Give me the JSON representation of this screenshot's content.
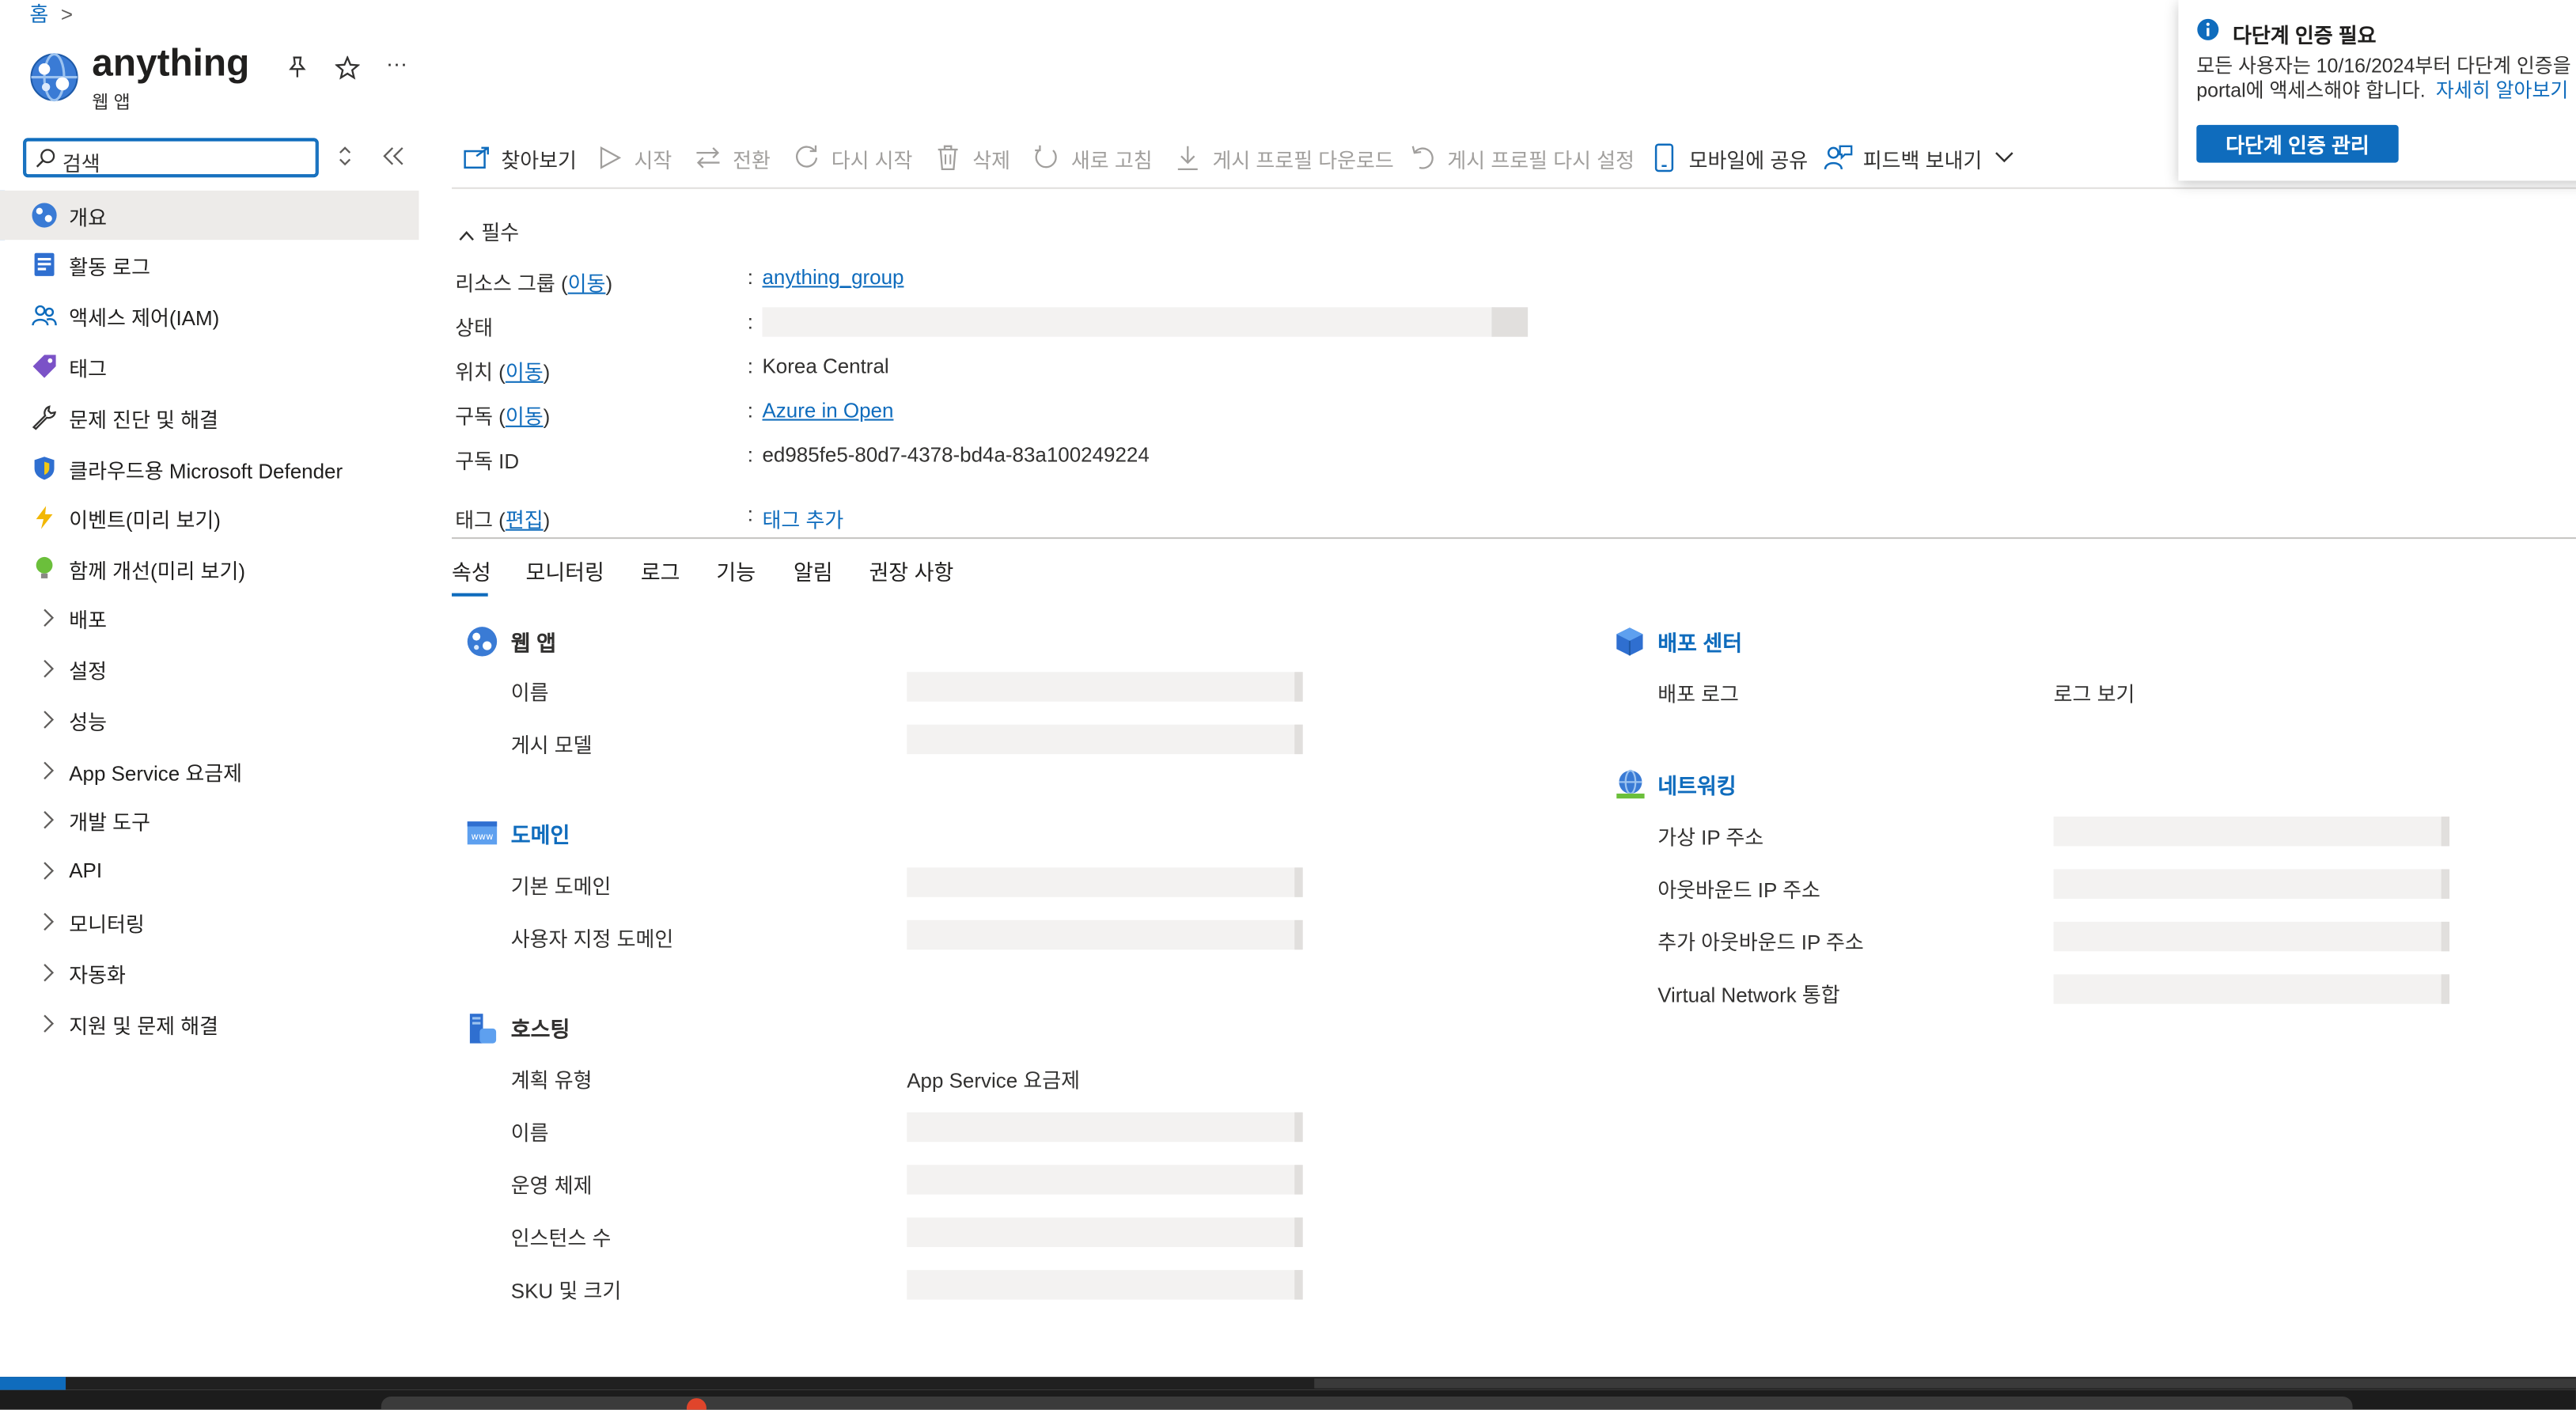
{
  "breadcrumb": {
    "home": "홈",
    "separator": ">"
  },
  "header": {
    "title": "anything",
    "subtitle": "웹 앱",
    "more": "···"
  },
  "search": {
    "value": "검색",
    "placeholder": "검색"
  },
  "sidebar": {
    "items": [
      {
        "label": "개요",
        "icon": "web-app-icon",
        "selected": true
      },
      {
        "label": "활동 로그",
        "icon": "activity-log-icon"
      },
      {
        "label": "액세스 제어(IAM)",
        "icon": "people-icon"
      },
      {
        "label": "태그",
        "icon": "tag-icon"
      },
      {
        "label": "문제 진단 및 해결",
        "icon": "wrench-icon"
      },
      {
        "label": "클라우드용 Microsoft Defender",
        "icon": "shield-icon"
      },
      {
        "label": "이벤트(미리 보기)",
        "icon": "lightning-icon"
      },
      {
        "label": "함께 개선(미리 보기)",
        "icon": "lightbulb-icon"
      },
      {
        "label": "배포",
        "icon": "chevron-right-icon",
        "group": true
      },
      {
        "label": "설정",
        "icon": "chevron-right-icon",
        "group": true
      },
      {
        "label": "성능",
        "icon": "chevron-right-icon",
        "group": true
      },
      {
        "label": "App Service 요금제",
        "icon": "chevron-right-icon",
        "group": true
      },
      {
        "label": "개발 도구",
        "icon": "chevron-right-icon",
        "group": true
      },
      {
        "label": "API",
        "icon": "chevron-right-icon",
        "group": true
      },
      {
        "label": "모니터링",
        "icon": "chevron-right-icon",
        "group": true
      },
      {
        "label": "자동화",
        "icon": "chevron-right-icon",
        "group": true
      },
      {
        "label": "지원 및 문제 해결",
        "icon": "chevron-right-icon",
        "group": true
      }
    ]
  },
  "toolbar": {
    "browse": "찾아보기",
    "start": "시작",
    "swap": "전환",
    "restart": "다시 시작",
    "delete": "삭제",
    "refresh": "새로 고침",
    "download_profile": "게시 프로필 다운로드",
    "reset_profile": "게시 프로필 다시 설정",
    "share_mobile": "모바일에 공유",
    "feedback": "피드백 보내기"
  },
  "essentials": {
    "header": "필수",
    "resource_group_label": "리소스 그룹 (",
    "move_link": "이동",
    "close_paren": ")",
    "resource_group_value": "anything_group",
    "status_label": "상태",
    "location_label": "위치 (",
    "location_value": "Korea Central",
    "subscription_label": "구독 (",
    "subscription_value": "Azure in Open",
    "subscription_id_label": "구독 ID",
    "subscription_id_value": "ed985fe5-80d7-4378-bd4a-83a100249224",
    "tags_label": "태그 (",
    "edit_link": "편집",
    "tags_value": "태그 추가",
    "colon": ":"
  },
  "tabs": [
    "속성",
    "모니터링",
    "로그",
    "기능",
    "알림",
    "권장 사항"
  ],
  "properties": {
    "web_app": {
      "title": "웹 앱",
      "name": "이름",
      "publish_model": "게시 모델"
    },
    "domain": {
      "title": "도메인",
      "default_domain": "기본 도메인",
      "custom_domain": "사용자 지정 도메인"
    },
    "hosting": {
      "title": "호스팅",
      "plan_type": "계획 유형",
      "plan_type_value": "App Service 요금제",
      "name": "이름",
      "os": "운영 체제",
      "instance_count": "인스턴스 수",
      "sku": "SKU 및 크기"
    },
    "deployment": {
      "title": "배포 센터",
      "log_label": "배포 로그",
      "log_link": "로그 보기"
    },
    "networking": {
      "title": "네트워킹",
      "virtual_ip": "가상 IP 주소",
      "outbound_ip": "아웃바운드 IP 주소",
      "additional_outbound_ip": "추가 아웃바운드 IP 주소",
      "vnet": "Virtual Network 통합"
    }
  },
  "notification": {
    "title": "다단계 인증 필요",
    "body_line1": "모든 사용자는 10/16/2024부터 다단계 인증을",
    "body_line2": "portal에 액세스해야 합니다.",
    "learn_more": "자세히 알아보기",
    "button": "다단계 인증 관리"
  },
  "colors": {
    "accent": "#0f6cbd",
    "selected_bg": "#edebe9",
    "skeleton": "#f3f2f1"
  }
}
